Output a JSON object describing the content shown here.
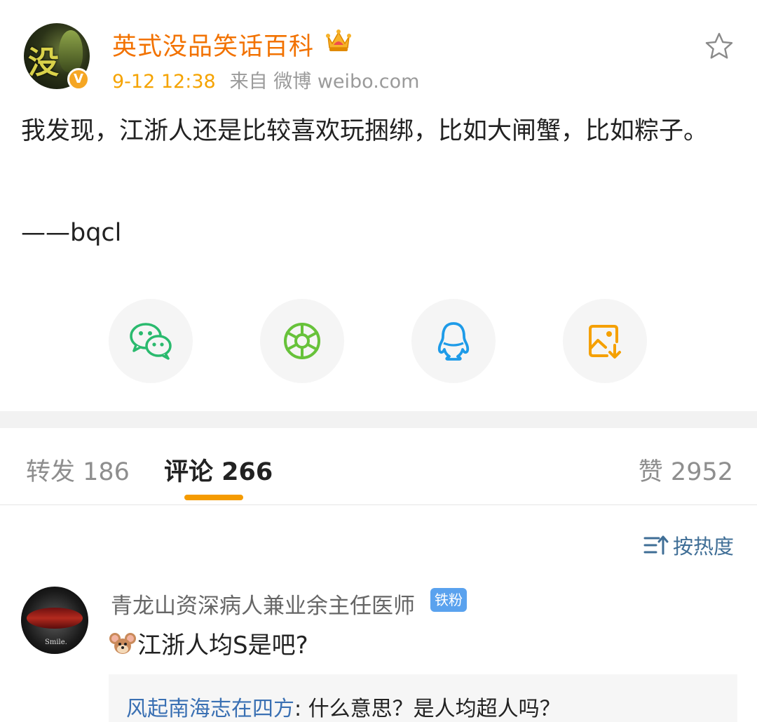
{
  "post": {
    "author": "英式没品笑话百科",
    "time": "9-12 12:38",
    "source": "来自 微博 weibo.com",
    "body": "我发现，江浙人还是比较喜欢玩捆绑，比如大闸蟹，比如粽子。",
    "signature": "——bqcl",
    "avatar_badge": "V"
  },
  "share": [
    {
      "icon": "wechat-icon",
      "color": "#2aba6e"
    },
    {
      "icon": "moments-icon",
      "color": "#67c23a"
    },
    {
      "icon": "qq-icon",
      "color": "#1e9be8"
    },
    {
      "icon": "save-image-icon",
      "color": "#f5a000"
    }
  ],
  "tabs": {
    "forward": "转发 186",
    "comments": "评论 266",
    "likes": "赞 2952"
  },
  "sort": {
    "label": "按热度"
  },
  "comment": {
    "user": "青龙山资深病人兼业余主任医师",
    "badge": "铁粉",
    "text": "江浙人均S是吧?",
    "avatar_caption": "Smile.",
    "reply": {
      "user": "风起南海志在四方",
      "text": ": 什么意思？是人均超人吗？"
    }
  },
  "colors": {
    "author_orange": "#f27200",
    "time_yellow": "#f5a300",
    "tab_underline": "#f59b00",
    "link_blue": "#3a70b3",
    "badge_blue": "#5aa2ee"
  }
}
